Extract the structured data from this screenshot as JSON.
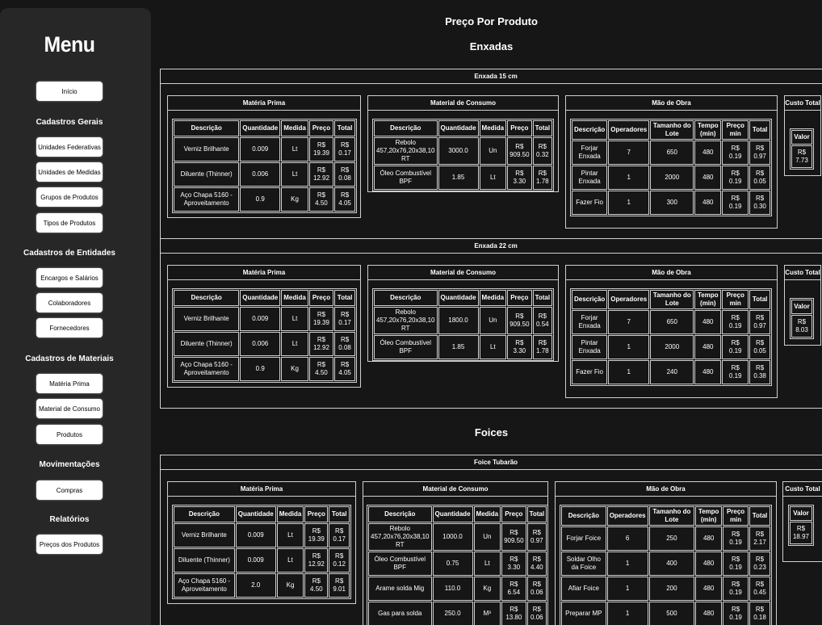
{
  "sidebar": {
    "title": "Menu",
    "home": "Início",
    "sections": [
      {
        "heading": "Cadastros Gerais",
        "items": [
          "Unidades Federativas",
          "Unidades de Medidas",
          "Grupos de Produtos",
          "Tipos de Produtos"
        ]
      },
      {
        "heading": "Cadastros de Entidades",
        "items": [
          "Encargos e Salários",
          "Colaboradores",
          "Fornecedores"
        ]
      },
      {
        "heading": "Cadastros de Materiais",
        "items": [
          "Matéria Prima",
          "Material de Consumo",
          "Produtos"
        ]
      },
      {
        "heading": "Movimentações",
        "items": [
          "Compras"
        ]
      },
      {
        "heading": "Relatórios",
        "items": [
          "Preços dos Produtos"
        ]
      }
    ]
  },
  "main": {
    "title": "Preço Por Produto",
    "groups": [
      {
        "name": "Enxadas",
        "products": [
          {
            "name": "Enxada 15 cm",
            "materia_prima": {
              "title": "Matéria Prima",
              "headers": [
                "Descrição",
                "Quantidade",
                "Medida",
                "Preço",
                "Total"
              ],
              "rows": [
                [
                  "Verniz Brilhante",
                  "0.009",
                  "Lt",
                  "R$ 19.39",
                  "R$ 0.17"
                ],
                [
                  "Diluente (Thinner)",
                  "0.006",
                  "Lt",
                  "R$ 12.92",
                  "R$ 0.08"
                ],
                [
                  "Aço Chapa 5160 - Aproveitamento",
                  "0.9",
                  "Kg",
                  "R$ 4.50",
                  "R$ 4.05"
                ]
              ]
            },
            "material_consumo": {
              "title": "Material de Consumo",
              "headers": [
                "Descrição",
                "Quantidade",
                "Medida",
                "Preço",
                "Total"
              ],
              "rows": [
                [
                  "Rebolo 457,20x76,20x38,10 RT",
                  "3000.0",
                  "Un",
                  "R$ 909.50",
                  "R$ 0.32"
                ],
                [
                  "Óleo Combustível BPF",
                  "1.85",
                  "Lt",
                  "R$ 3.30",
                  "R$ 1.78"
                ]
              ]
            },
            "mao_de_obra": {
              "title": "Mão de Obra",
              "headers": [
                "Descrição",
                "Operadores",
                "Tamanho do Lote",
                "Tempo (min)",
                "Preço min",
                "Total"
              ],
              "rows": [
                [
                  "Forjar Enxada",
                  "7",
                  "650",
                  "480",
                  "R$ 0.19",
                  "R$ 0.97"
                ],
                [
                  "Pintar Enxada",
                  "1",
                  "2000",
                  "480",
                  "R$ 0.19",
                  "R$ 0.05"
                ],
                [
                  "Fazer Fio",
                  "1",
                  "300",
                  "480",
                  "R$ 0.19",
                  "R$ 0.30"
                ]
              ]
            },
            "custo_total": {
              "title": "Custo Total",
              "header": "Valor",
              "value": "R$ 7.73"
            }
          },
          {
            "name": "Enxada 22 cm",
            "materia_prima": {
              "title": "Matéria Prima",
              "headers": [
                "Descrição",
                "Quantidade",
                "Medida",
                "Preço",
                "Total"
              ],
              "rows": [
                [
                  "Verniz Brilhante",
                  "0.009",
                  "Lt",
                  "R$ 19.39",
                  "R$ 0.17"
                ],
                [
                  "Diluente (Thinner)",
                  "0.006",
                  "Lt",
                  "R$ 12.92",
                  "R$ 0.08"
                ],
                [
                  "Aço Chapa 5160 - Aproveitamento",
                  "0.9",
                  "Kg",
                  "R$ 4.50",
                  "R$ 4.05"
                ]
              ]
            },
            "material_consumo": {
              "title": "Material de Consumo",
              "headers": [
                "Descrição",
                "Quantidade",
                "Medida",
                "Preço",
                "Total"
              ],
              "rows": [
                [
                  "Rebolo 457,20x76,20x38,10 RT",
                  "1800.0",
                  "Un",
                  "R$ 909.50",
                  "R$ 0.54"
                ],
                [
                  "Óleo Combustível BPF",
                  "1.85",
                  "Lt",
                  "R$ 3.30",
                  "R$ 1.78"
                ]
              ]
            },
            "mao_de_obra": {
              "title": "Mão de Obra",
              "headers": [
                "Descrição",
                "Operadores",
                "Tamanho do Lote",
                "Tempo (min)",
                "Preço min",
                "Total"
              ],
              "rows": [
                [
                  "Forjar Enxada",
                  "7",
                  "650",
                  "480",
                  "R$ 0.19",
                  "R$ 0.97"
                ],
                [
                  "Pintar Enxada",
                  "1",
                  "2000",
                  "480",
                  "R$ 0.19",
                  "R$ 0.05"
                ],
                [
                  "Fazer Fio",
                  "1",
                  "240",
                  "480",
                  "R$ 0.19",
                  "R$ 0.38"
                ]
              ]
            },
            "custo_total": {
              "title": "Custo Total",
              "header": "Valor",
              "value": "R$ 8.03"
            }
          }
        ]
      },
      {
        "name": "Foices",
        "products": [
          {
            "name": "Foice Tubarão",
            "materia_prima": {
              "title": "Matéria Prima",
              "headers": [
                "Descrição",
                "Quantidade",
                "Medida",
                "Preço",
                "Total"
              ],
              "rows": [
                [
                  "Verniz Brilhante",
                  "0.009",
                  "Lt",
                  "R$ 19.39",
                  "R$ 0.17"
                ],
                [
                  "Diluente (Thinner)",
                  "0.009",
                  "Lt",
                  "R$ 12.92",
                  "R$ 0.12"
                ],
                [
                  "Aço Chapa 5160 - Aproveitamento",
                  "2.0",
                  "Kg",
                  "R$ 4.50",
                  "R$ 9.01"
                ]
              ]
            },
            "material_consumo": {
              "title": "Material de Consumo",
              "headers": [
                "Descrição",
                "Quantidade",
                "Medida",
                "Preço",
                "Total"
              ],
              "rows": [
                [
                  "Rebolo 457,20x76,20x38,10 RT",
                  "1000.0",
                  "Un",
                  "R$ 909.50",
                  "R$ 0.97"
                ],
                [
                  "Óleo Combustível BPF",
                  "0.75",
                  "Lt",
                  "R$ 3.30",
                  "R$ 4.40"
                ],
                [
                  "Arame solda Mig",
                  "110.0",
                  "Kg",
                  "R$ 6.54",
                  "R$ 0.06"
                ],
                [
                  "Gas para solda",
                  "250.0",
                  "M³",
                  "R$ 13.80",
                  "R$ 0.06"
                ]
              ]
            },
            "mao_de_obra": {
              "title": "Mão de Obra",
              "headers": [
                "Descrição",
                "Operadores",
                "Tamanho do Lote",
                "Tempo (min)",
                "Preço min",
                "Total"
              ],
              "rows": [
                [
                  "Forjar Foice",
                  "6",
                  "250",
                  "480",
                  "R$ 0.19",
                  "R$ 2.17"
                ],
                [
                  "Soldar Olho da Foice",
                  "1",
                  "400",
                  "480",
                  "R$ 0.19",
                  "R$ 0.23"
                ],
                [
                  "Afiar Foice",
                  "1",
                  "200",
                  "480",
                  "R$ 0.19",
                  "R$ 0.45"
                ],
                [
                  "Preparar MP",
                  "1",
                  "500",
                  "480",
                  "R$ 0.19",
                  "R$ 0.18"
                ]
              ]
            },
            "custo_total": {
              "title": "Custo Total",
              "header": "Valor",
              "value": "R$ 18.97"
            }
          }
        ]
      }
    ]
  }
}
